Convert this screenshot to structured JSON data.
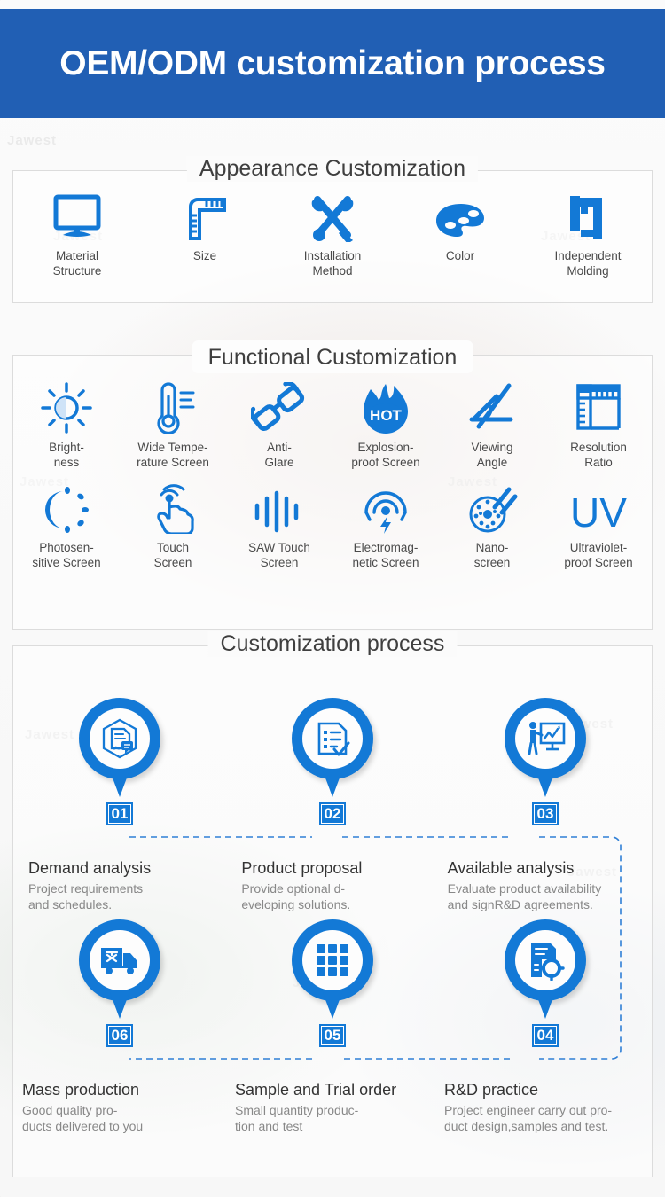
{
  "colors": {
    "header_bg": "#215fb4",
    "icon_blue": "#1379d6",
    "title_text": "#3f3f3f",
    "body_text": "#4a4a4a",
    "muted_text": "#888888",
    "box_border": "#dcdcdc",
    "page_bg": "#fbfbfb"
  },
  "header": {
    "title": "OEM/ODM customization process"
  },
  "watermark": {
    "text": "Jawest"
  },
  "appearance": {
    "title": "Appearance Customization",
    "items": [
      {
        "icon": "monitor-icon",
        "label": "Material\nStructure",
        "line1": "Material",
        "line2": "Structure"
      },
      {
        "icon": "ruler-icon",
        "label": "Size",
        "line1": "Size",
        "line2": ""
      },
      {
        "icon": "tools-icon",
        "label": "Installation\nMethod",
        "line1": "Installation",
        "line2": "Method"
      },
      {
        "icon": "palette-icon",
        "label": "Color",
        "line1": "Color",
        "line2": ""
      },
      {
        "icon": "clamp-icon",
        "label": "Independent\nMolding",
        "line1": "Independent",
        "line2": "Molding"
      }
    ]
  },
  "functional": {
    "title": "Functional Customization",
    "row1": [
      {
        "icon": "sun-brightness-icon",
        "line1": "Bright-",
        "line2": "ness"
      },
      {
        "icon": "thermometer-icon",
        "line1": "Wide Tempe-",
        "line2": "rature Screen"
      },
      {
        "icon": "glasses-icon",
        "line1": "Anti-",
        "line2": "Glare"
      },
      {
        "icon": "flame-hot-icon",
        "line1": "Explosion-",
        "line2": "proof Screen",
        "glyph": "HOT"
      },
      {
        "icon": "angle-protractor-icon",
        "line1": "Viewing",
        "line2": "Angle"
      },
      {
        "icon": "ruler-square-icon",
        "line1": "Resolution",
        "line2": "Ratio"
      }
    ],
    "row2": [
      {
        "icon": "photosensitive-icon",
        "line1": "Photosen-",
        "line2": "sitive Screen"
      },
      {
        "icon": "touch-hand-icon",
        "line1": "Touch",
        "line2": "Screen"
      },
      {
        "icon": "waveform-icon",
        "line1": "SAW Touch",
        "line2": "Screen"
      },
      {
        "icon": "electromagnetic-icon",
        "line1": "Electromag-",
        "line2": "netic Screen"
      },
      {
        "icon": "nano-icon",
        "line1": "Nano-",
        "line2": "screen"
      },
      {
        "icon": "uv-text-icon",
        "line1": "Ultraviolet-",
        "line2": "proof Screen",
        "glyph": "UV"
      }
    ]
  },
  "process": {
    "title": "Customization process",
    "steps_row1": [
      {
        "number": "01",
        "icon": "certificate-hexagon-icon",
        "heading": "Demand analysis",
        "desc_line1": "Project requirements",
        "desc_line2": "and schedules."
      },
      {
        "number": "02",
        "icon": "checklist-document-icon",
        "heading": "Product proposal",
        "desc_line1": "Provide optional d-",
        "desc_line2": "eveloping solutions."
      },
      {
        "number": "03",
        "icon": "presentation-board-icon",
        "heading": "Available analysis",
        "desc_line1": "Evaluate product availability",
        "desc_line2": "and signR&D agreements."
      }
    ],
    "steps_row2": [
      {
        "number": "06",
        "icon": "delivery-truck-icon",
        "heading": "Mass production",
        "desc_line1": "Good quality pro-",
        "desc_line2": "ducts delivered to you"
      },
      {
        "number": "05",
        "icon": "grid-squares-icon",
        "heading": "Sample and Trial order",
        "desc_line1": "Small quantity produc-",
        "desc_line2": "tion and test"
      },
      {
        "number": "04",
        "icon": "document-gear-icon",
        "heading": "R&D practice",
        "desc_line1": "Project engineer carry out pro-",
        "desc_line2": "duct design,samples and test."
      }
    ]
  }
}
